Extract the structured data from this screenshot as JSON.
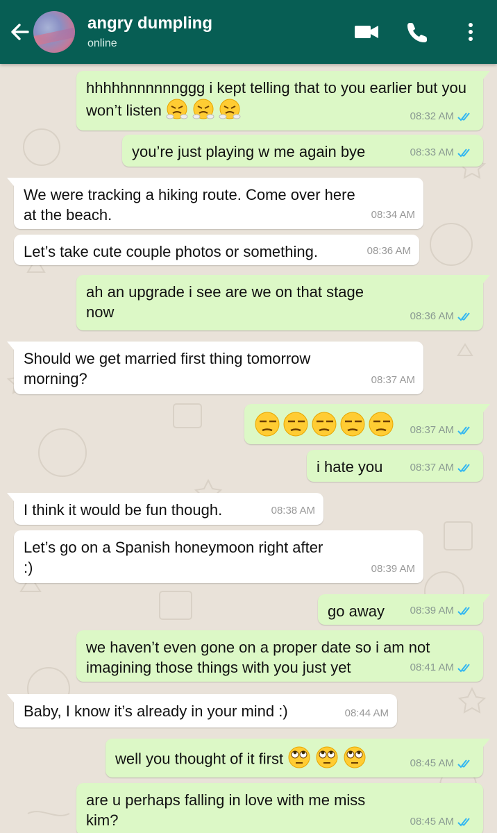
{
  "header": {
    "contact_name": "angry dumpling",
    "status": "online",
    "back_icon": "back-arrow-icon",
    "video_icon": "video-call-icon",
    "call_icon": "phone-icon",
    "menu_icon": "more-vertical-icon",
    "color": "#075e54"
  },
  "colors": {
    "outgoing": "#dcf8c6",
    "incoming": "#ffffff",
    "ticks": "#34b7f1",
    "wallpaper": "#e9e2d9"
  },
  "messages": [
    {
      "dir": "out",
      "text": "hhhhhnnnnnnggg i kept telling that to you earlier but you won’t listen",
      "emoji": "face-with-steam-from-nose x3",
      "time": "08:32 AM"
    },
    {
      "dir": "out",
      "text": "you’re just playing w me again bye",
      "time": "08:33 AM"
    },
    {
      "dir": "in",
      "text": "We were tracking a hiking route. Come over here at the beach.",
      "time": "08:34 AM"
    },
    {
      "dir": "in",
      "text": "Let’s take cute couple photos or something.",
      "time": "08:36 AM"
    },
    {
      "dir": "out",
      "text": "ah an upgrade i see are we on that stage now",
      "time": "08:36 AM"
    },
    {
      "dir": "in",
      "text": "Should we get married first thing tomorrow morning?",
      "time": "08:37 AM"
    },
    {
      "dir": "out",
      "text": "",
      "emoji": "unamused-face x5",
      "time": "08:37 AM"
    },
    {
      "dir": "out",
      "text": "i hate you",
      "time": "08:37 AM"
    },
    {
      "dir": "in",
      "text": "I think it would be fun though.",
      "time": "08:38 AM"
    },
    {
      "dir": "in",
      "text": "Let’s go on a Spanish honeymoon right after :)",
      "time": "08:39 AM"
    },
    {
      "dir": "out",
      "text": "go away",
      "time": "08:39 AM"
    },
    {
      "dir": "out",
      "text": "we haven’t even gone on a proper date so i am not imagining those things with you just yet",
      "time": "08:41 AM"
    },
    {
      "dir": "in",
      "text": "Baby, I know it’s already in your mind :)",
      "time": "08:44 AM"
    },
    {
      "dir": "out",
      "text": "well you thought of it first",
      "emoji": "face-with-rolling-eyes x3",
      "time": "08:45 AM"
    },
    {
      "dir": "out",
      "text": "are u perhaps falling in love with me miss kim?",
      "time": "08:45 AM"
    }
  ]
}
